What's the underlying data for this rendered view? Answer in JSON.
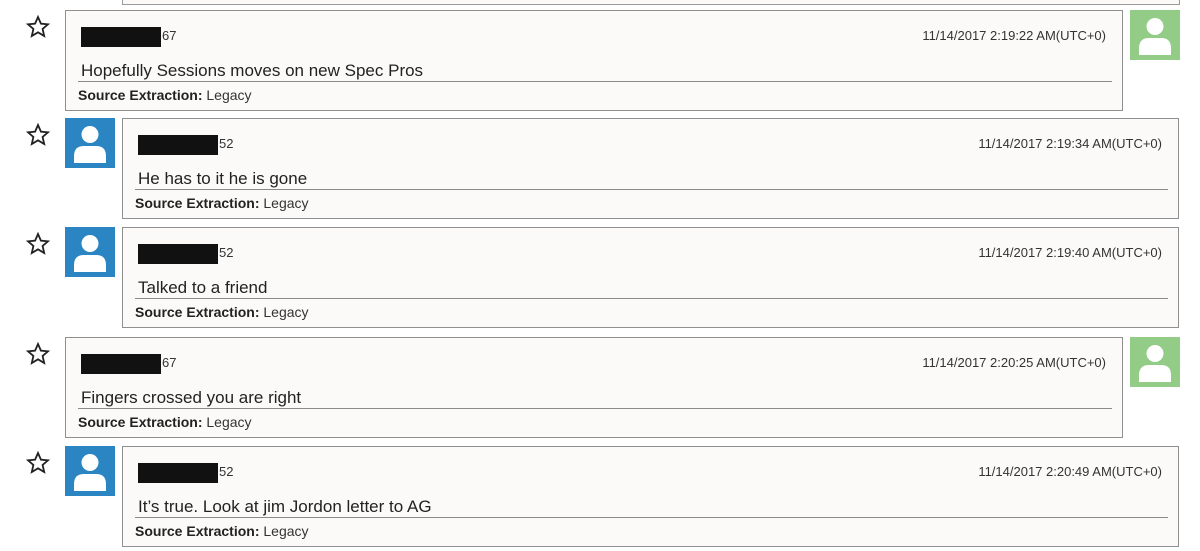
{
  "messages": [
    {
      "direction": "sent",
      "sender_suffix": "67",
      "timestamp": "11/14/2017 2:19:22 AM(UTC+0)",
      "text": "Hopefully Sessions moves on new Spec Pros",
      "source_label": "Source Extraction:",
      "source_value": "Legacy",
      "avatar_color": "#92cc86"
    },
    {
      "direction": "received",
      "sender_suffix": "52",
      "timestamp": "11/14/2017 2:19:34 AM(UTC+0)",
      "text": "He has to it he is gone",
      "source_label": "Source Extraction:",
      "source_value": "Legacy",
      "avatar_color": "#2b85c2"
    },
    {
      "direction": "received",
      "sender_suffix": "52",
      "timestamp": "11/14/2017 2:19:40 AM(UTC+0)",
      "text": "Talked to a friend",
      "source_label": "Source Extraction:",
      "source_value": "Legacy",
      "avatar_color": "#2b85c2"
    },
    {
      "direction": "sent",
      "sender_suffix": "67",
      "timestamp": "11/14/2017 2:20:25 AM(UTC+0)",
      "text": "Fingers crossed you are right",
      "source_label": "Source Extraction:",
      "source_value": "Legacy",
      "avatar_color": "#92cc86"
    },
    {
      "direction": "received",
      "sender_suffix": "52",
      "timestamp": "11/14/2017 2:20:49 AM(UTC+0)",
      "text": "It’s true. Look at jim Jordon letter to AG",
      "source_label": "Source Extraction:",
      "source_value": "Legacy",
      "avatar_color": "#2b85c2"
    }
  ],
  "icons": {
    "star": "star-outline-icon",
    "avatar": "user-avatar-icon"
  }
}
